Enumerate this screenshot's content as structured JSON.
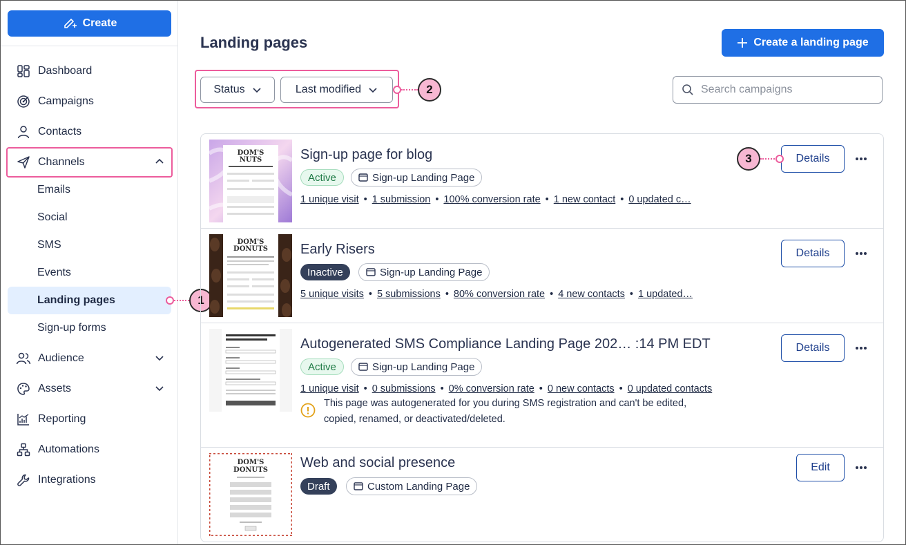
{
  "sidebar": {
    "create_label": "Create",
    "items": [
      {
        "label": "Dashboard",
        "icon": "dashboard-icon"
      },
      {
        "label": "Campaigns",
        "icon": "target-icon"
      },
      {
        "label": "Contacts",
        "icon": "person-icon"
      },
      {
        "label": "Channels",
        "icon": "send-icon"
      },
      {
        "label": "Audience",
        "icon": "people-icon"
      },
      {
        "label": "Assets",
        "icon": "palette-icon"
      },
      {
        "label": "Reporting",
        "icon": "chart-icon"
      },
      {
        "label": "Automations",
        "icon": "flow-icon"
      },
      {
        "label": "Integrations",
        "icon": "wrench-icon"
      }
    ],
    "channels_sub": [
      "Emails",
      "Social",
      "SMS",
      "Events",
      "Landing pages",
      "Sign-up forms"
    ]
  },
  "callouts": [
    "1",
    "2",
    "3"
  ],
  "header": {
    "title": "Landing pages",
    "create_button": "Create a landing page"
  },
  "filters": {
    "status": "Status",
    "sort": "Last modified",
    "search_placeholder": "Search campaigns"
  },
  "pages": [
    {
      "title": "Sign-up page for blog",
      "status": "Active",
      "type": "Sign-up Landing Page",
      "stats": [
        "1 unique visit",
        "1 submission",
        "100% conversion rate",
        "1 new contact",
        "0 updated c…"
      ],
      "action": "Details"
    },
    {
      "title": "Early Risers",
      "status": "Inactive",
      "type": "Sign-up Landing Page",
      "stats": [
        "5 unique visits",
        "5 submissions",
        "80% conversion rate",
        "4 new contacts",
        "1 updated…"
      ],
      "action": "Details"
    },
    {
      "title": "Autogenerated SMS Compliance Landing Page 202…  :14 PM EDT",
      "status": "Active",
      "type": "Sign-up Landing Page",
      "stats": [
        "1 unique visit",
        "0 submissions",
        "0% conversion rate",
        "0 new contacts",
        "0 updated contacts"
      ],
      "notice": "This page was autogenerated for you during SMS registration and can't be edited, copied, renamed, or deactivated/deleted.",
      "action": "Details"
    },
    {
      "title": "Web and social presence",
      "status": "Draft",
      "type": "Custom Landing Page",
      "stats": [],
      "action": "Edit"
    }
  ],
  "colors": {
    "accent": "#1f6fe5",
    "highlight": "#ec5c9c",
    "callout_fill": "#f7b7d2",
    "active_nav": "#e3efff"
  }
}
